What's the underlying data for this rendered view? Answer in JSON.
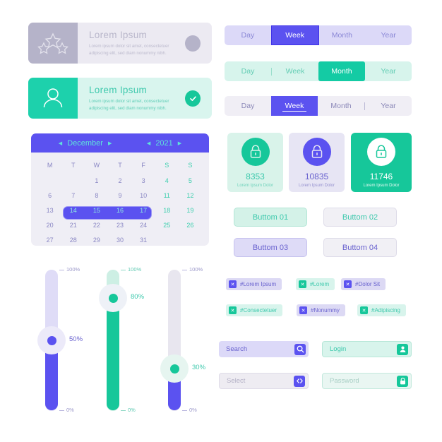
{
  "cards": [
    {
      "name": "star-card",
      "icon": "star-icon",
      "title": "Lorem Ipsum",
      "desc": "Lorem ipsum dolor sit amet, consectetuer adipiscing elit, sed diam nonummy nibh.",
      "badge": "circle-badge"
    },
    {
      "name": "user-card",
      "icon": "user-icon",
      "title": "Lorem Ipsum",
      "desc": "Lorem ipsum dolor sit amet, consectetuer adipiscing elit, sed diam nonummy nibh.",
      "badge": "check-badge"
    }
  ],
  "calendar": {
    "month": "December",
    "year": "2021",
    "prev_arrow": "◀",
    "next_arrow": "▶",
    "weekdays": [
      "M",
      "T",
      "W",
      "T",
      "F",
      "S",
      "S"
    ],
    "weeks": [
      [
        "",
        "",
        "1",
        "2",
        "3",
        "4",
        "5"
      ],
      [
        "6",
        "7",
        "8",
        "9",
        "10",
        "11",
        "12"
      ],
      [
        "13",
        "14",
        "15",
        "16",
        "17",
        "18",
        "19"
      ],
      [
        "20",
        "21",
        "22",
        "23",
        "24",
        "25",
        "26"
      ],
      [
        "27",
        "28",
        "29",
        "30",
        "31",
        "",
        ""
      ]
    ],
    "selected_range": [
      "14",
      "15",
      "16",
      "17"
    ]
  },
  "segments": [
    {
      "name": "segment-purple",
      "items": [
        "Day",
        "Week",
        "Month",
        "Year"
      ],
      "active": "Week",
      "dividers": []
    },
    {
      "name": "segment-teal",
      "items": [
        "Day",
        "Week",
        "Month",
        "Year"
      ],
      "active": "Month",
      "dividers": [
        0
      ]
    },
    {
      "name": "segment-light",
      "items": [
        "Day",
        "Week",
        "Month",
        "Year"
      ],
      "active": "Week",
      "dividers": [
        2
      ]
    }
  ],
  "stats": [
    {
      "value": "8353",
      "caption": "Lorem Ipsum Dolor",
      "icon": "lock-icon"
    },
    {
      "value": "10835",
      "caption": "Lorem Ipsum Dolor",
      "icon": "lock-icon"
    },
    {
      "value": "11746",
      "caption": "Lorem Ipsum Dolor",
      "icon": "lock-icon"
    }
  ],
  "buttons": [
    {
      "label": "Buttom 01"
    },
    {
      "label": "Buttom 02"
    },
    {
      "label": "Buttom 03"
    },
    {
      "label": "Buttom 04"
    }
  ],
  "tags": [
    {
      "label": "#Lorem Ipsum",
      "close": "✕",
      "style": "purple"
    },
    {
      "label": "#Lorem",
      "close": "✕",
      "style": "teal"
    },
    {
      "label": "#Dolor Sit",
      "close": "✕",
      "style": "purple"
    },
    {
      "label": "#Consectetuer",
      "close": "✕",
      "style": "teal"
    },
    {
      "label": "#Nonummy",
      "close": "✕",
      "style": "purple"
    },
    {
      "label": "#Adipiscing",
      "close": "✕",
      "style": "teal"
    }
  ],
  "fields": [
    {
      "label": "Search",
      "icon": "search-icon"
    },
    {
      "label": "Login",
      "icon": "user-icon"
    },
    {
      "label": "Select",
      "icon": "code-icon"
    },
    {
      "label": "Password",
      "icon": "lock-icon"
    }
  ],
  "sliders": [
    {
      "value": "50%",
      "max_label": "100%",
      "min_label": "0%",
      "value_num": 50
    },
    {
      "value": "80%",
      "max_label": "100%",
      "min_label": "0%",
      "value_num": 80
    },
    {
      "value": "30%",
      "max_label": "100%",
      "min_label": "0%",
      "value_num": 30
    }
  ],
  "colors": {
    "purple": "#5b52f0",
    "teal": "#16c79a",
    "gray_purple": "#b5b3c9",
    "light_purple": "#dcd9f8",
    "light_teal": "#d8f4ec"
  }
}
